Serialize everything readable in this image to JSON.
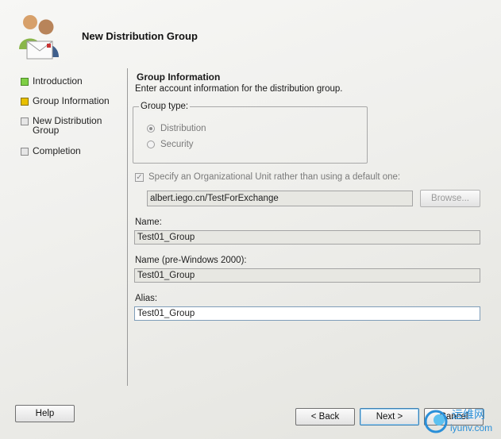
{
  "dialog": {
    "title": "New Distribution Group"
  },
  "nav": {
    "items": [
      {
        "label": "Introduction",
        "state": "done"
      },
      {
        "label": "Group Information",
        "state": "current"
      },
      {
        "label": "New Distribution Group",
        "state": "pending"
      },
      {
        "label": "Completion",
        "state": "pending"
      }
    ]
  },
  "main": {
    "section_title": "Group Information",
    "section_description": "Enter account information for the distribution group.",
    "group_type": {
      "legend": "Group type:",
      "options": [
        {
          "label": "Distribution",
          "selected": true
        },
        {
          "label": "Security",
          "selected": false
        }
      ]
    },
    "ou_checkbox": {
      "label": "Specify an Organizational Unit rather than using a default one:",
      "checked": true
    },
    "ou_path": "albert.iego.cn/TestForExchange",
    "browse_label": "Browse...",
    "name_label": "Name:",
    "name_value": "Test01_Group",
    "pre2000_label": "Name (pre-Windows 2000):",
    "pre2000_value": "Test01_Group",
    "alias_label": "Alias:",
    "alias_value": "Test01_Group"
  },
  "footer": {
    "help_label": "Help",
    "back_label": "< Back",
    "next_label": "Next >",
    "cancel_label": "Cancel"
  },
  "watermark": {
    "text_cn": "运维网",
    "text_url": "iyunv.com"
  },
  "colors": {
    "nav_done": "#7fcf45",
    "nav_current": "#e8c000",
    "watermark_blue": "#2a8fd8"
  }
}
